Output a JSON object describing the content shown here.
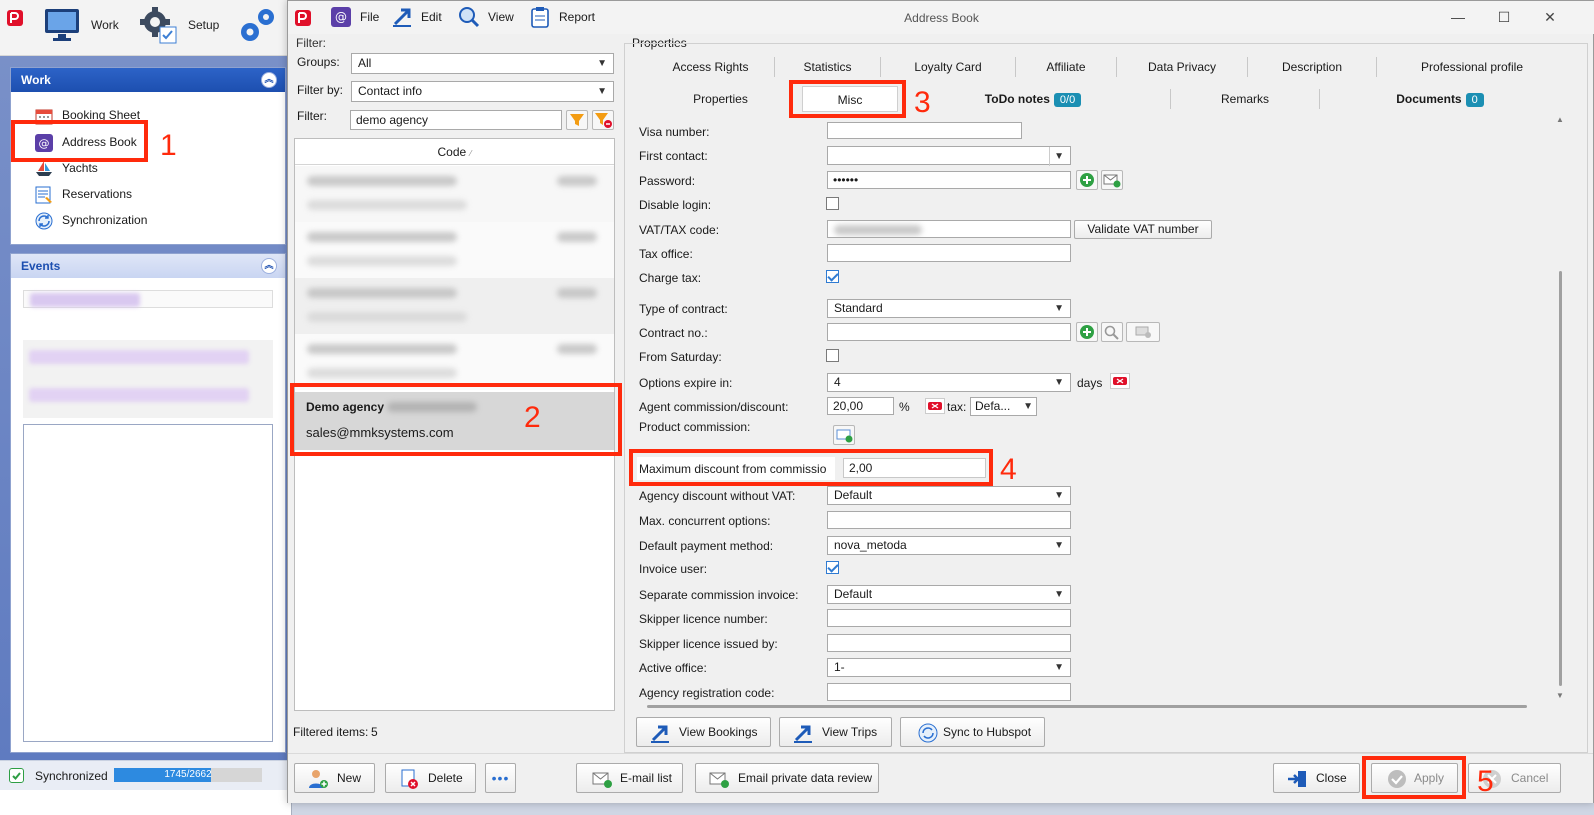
{
  "main_toolbar": {
    "work_label": "Work",
    "setup_label": "Setup"
  },
  "work_panel": {
    "title": "Work",
    "items": [
      {
        "label": "Booking Sheet"
      },
      {
        "label": "Address Book"
      },
      {
        "label": "Yachts"
      },
      {
        "label": "Reservations"
      },
      {
        "label": "Synchronization"
      }
    ]
  },
  "events_panel": {
    "title": "Events"
  },
  "status": {
    "label": "Synchronized",
    "progress_text": "1745/2662",
    "progress_done": 1745,
    "progress_total": 2662
  },
  "dialog": {
    "title": "Address Book",
    "menu": {
      "file": "File",
      "edit": "Edit",
      "view": "View",
      "report": "Report"
    }
  },
  "filter": {
    "section_label": "Filter:",
    "groups_label": "Groups:",
    "groups_value": "All",
    "filter_by_label": "Filter by:",
    "filter_by_value": "Contact info",
    "filter_label": "Filter:",
    "filter_value": "demo agency"
  },
  "list": {
    "column_header": "Code",
    "selected_name": "Demo agency",
    "selected_email": "sales@mmksystems.com",
    "filtered_label": "Filtered items:",
    "filtered_count": "5"
  },
  "properties": {
    "section_label": "Properties",
    "tabs_row1": [
      "Access Rights",
      "Statistics",
      "Loyalty Card",
      "Affiliate",
      "Data Privacy",
      "Description",
      "Professional profile"
    ],
    "tabs_row2": {
      "properties": "Properties",
      "misc": "Misc",
      "todo": "ToDo notes",
      "todo_badge": "0/0",
      "remarks": "Remarks",
      "documents": "Documents",
      "documents_badge": "0"
    },
    "fields": {
      "visa_number": "Visa number:",
      "first_contact": "First contact:",
      "password": "Password:",
      "password_value": "••••••",
      "disable_login": "Disable login:",
      "vat_code": "VAT/TAX code:",
      "validate_vat": "Validate VAT number",
      "tax_office": "Tax office:",
      "charge_tax": "Charge tax:",
      "type_of_contract": "Type of contract:",
      "type_of_contract_value": "Standard",
      "contract_no": "Contract no.:",
      "from_saturday": "From Saturday:",
      "options_expire": "Options expire in:",
      "options_expire_value": "4",
      "days": "days",
      "agent_commission": "Agent commission/discount:",
      "agent_commission_value": "20,00",
      "percent": "%",
      "tax_label": "tax:",
      "tax_value": "Defa...",
      "product_commission": "Product commission:",
      "max_discount": "Maximum discount from commissio",
      "max_discount_value": "2,00",
      "agency_discount": "Agency discount without VAT:",
      "agency_discount_value": "Default",
      "max_concurrent": "Max. concurrent options:",
      "default_payment": "Default payment method:",
      "default_payment_value": "nova_metoda",
      "invoice_user": "Invoice user:",
      "separate_commission": "Separate commission invoice:",
      "separate_commission_value": "Default",
      "skipper_licence_number": "Skipper licence number:",
      "skipper_licence_issued": "Skipper licence issued by:",
      "active_office": "Active office:",
      "active_office_value": "1-",
      "agency_registration": "Agency registration code:"
    },
    "buttons": {
      "view_bookings": "View Bookings",
      "view_trips": "View Trips",
      "sync_hubspot": "Sync to Hubspot"
    }
  },
  "bottom_buttons": {
    "new": "New",
    "delete": "Delete",
    "more": "•••",
    "email_list": "E-mail list",
    "email_private": "Email private data review",
    "close": "Close",
    "apply": "Apply",
    "cancel": "Cancel"
  },
  "callouts": [
    "1",
    "2",
    "3",
    "4",
    "5"
  ],
  "colors": {
    "highlight_red": "#ff2a0c",
    "work_header": "#2d63c8",
    "badge": "#1b8fb3",
    "progress": "#2d8ae0"
  }
}
